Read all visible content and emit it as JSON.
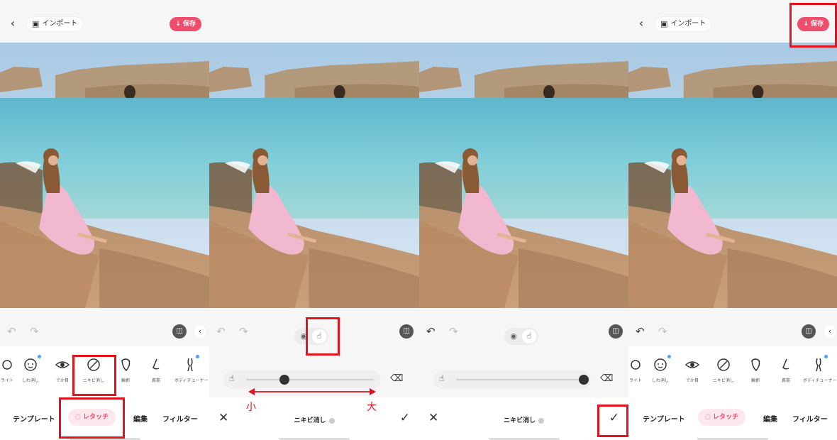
{
  "header": {
    "back_icon": "chevron-left-icon",
    "import_label": "インポート",
    "save_label": "↓ 保存"
  },
  "tools": [
    {
      "label": "ライト",
      "icon": "brightness-icon"
    },
    {
      "label": "しわ消し",
      "icon": "face-icon"
    },
    {
      "label": "でか目",
      "icon": "eye-icon"
    },
    {
      "label": "ニキビ消し",
      "icon": "acne-icon"
    },
    {
      "label": "輪郭",
      "icon": "face-contour-icon"
    },
    {
      "label": "鼻筋",
      "icon": "nose-icon"
    },
    {
      "label": "ボディチューナー",
      "icon": "body-icon"
    }
  ],
  "nav": {
    "template": "テンプレート",
    "retouch": "レタッチ",
    "edit": "編集",
    "filter": "フィルター"
  },
  "acne_panel": {
    "title": "ニキビ消し",
    "slider_value_step2": 0.3,
    "slider_value_step3": 1.0,
    "small_label": "小",
    "large_label": "大"
  },
  "colors": {
    "accent": "#f04d6d",
    "annotation": "#e1141e"
  }
}
